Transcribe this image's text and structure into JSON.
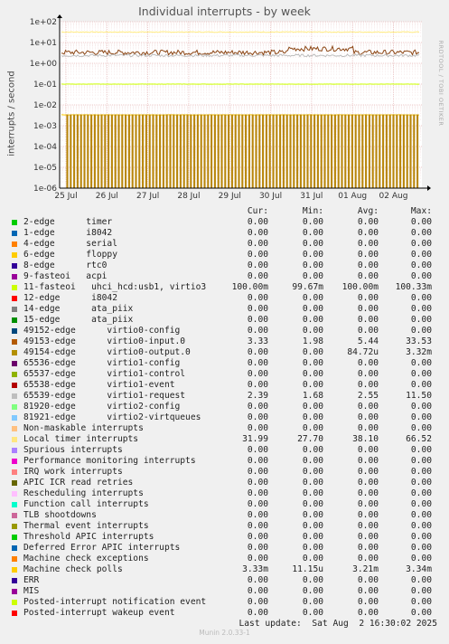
{
  "chart_data": {
    "type": "line",
    "title": "Individual interrupts - by week",
    "ylabel": "interrupts / second",
    "yscale": "log",
    "ylim": [
      1e-06,
      100
    ],
    "yticks": [
      "1e+02",
      "1e+01",
      "1e+00",
      "1e-01",
      "1e-02",
      "1e-03",
      "1e-04",
      "1e-05",
      "1e-06"
    ],
    "xticks": [
      "25 Jul",
      "26 Jul",
      "27 Jul",
      "28 Jul",
      "29 Jul",
      "30 Jul",
      "31 Jul",
      "01 Aug",
      "02 Aug"
    ],
    "side_label": "RRDTOOL / TOBI OETIKER",
    "grid": true,
    "series": [
      {
        "name": "Local timer interrupts",
        "color": "#ffeb80",
        "level": 31.99
      },
      {
        "name": "49153-edge virtio0-input.0",
        "color": "#8b4513",
        "level": 3.33
      },
      {
        "name": "65539-edge virtio1-request",
        "color": "#bbbbbb",
        "level": 2.39
      },
      {
        "name": "11-fasteoi uhci_hcd:usb1, virtio3",
        "color": "#ccff00",
        "level": 0.1
      },
      {
        "name": "Machine check polls",
        "color": "#ffcc00",
        "level": 0.00333
      },
      {
        "name": "49154-edge virtio0-output.0",
        "color": "#b8860b",
        "level": 8.5e-05
      }
    ]
  },
  "legend": {
    "headers": {
      "cur": "Cur:",
      "min": "Min:",
      "avg": "Avg:",
      "max": "Max:"
    },
    "rows": [
      {
        "name": "2-edge      timer",
        "color": "#00cc00",
        "cur": "0.00",
        "min": "0.00",
        "avg": "0.00",
        "max": "0.00"
      },
      {
        "name": "1-edge      i8042",
        "color": "#0066b3",
        "cur": "0.00",
        "min": "0.00",
        "avg": "0.00",
        "max": "0.00"
      },
      {
        "name": "4-edge      serial",
        "color": "#ff8000",
        "cur": "0.00",
        "min": "0.00",
        "avg": "0.00",
        "max": "0.00"
      },
      {
        "name": "6-edge      floppy",
        "color": "#ffcc00",
        "cur": "0.00",
        "min": "0.00",
        "avg": "0.00",
        "max": "0.00"
      },
      {
        "name": "8-edge      rtc0",
        "color": "#330099",
        "cur": "0.00",
        "min": "0.00",
        "avg": "0.00",
        "max": "0.00"
      },
      {
        "name": "9-fasteoi   acpi",
        "color": "#990099",
        "cur": "0.00",
        "min": "0.00",
        "avg": "0.00",
        "max": "0.00"
      },
      {
        "name": "11-fasteoi   uhci_hcd:usb1, virtio3",
        "color": "#ccff00",
        "cur": "100.00m",
        "min": "99.67m",
        "avg": "100.00m",
        "max": "100.33m"
      },
      {
        "name": "12-edge      i8042",
        "color": "#ff0000",
        "cur": "0.00",
        "min": "0.00",
        "avg": "0.00",
        "max": "0.00"
      },
      {
        "name": "14-edge      ata_piix",
        "color": "#808080",
        "cur": "0.00",
        "min": "0.00",
        "avg": "0.00",
        "max": "0.00"
      },
      {
        "name": "15-edge      ata_piix",
        "color": "#008f00",
        "cur": "0.00",
        "min": "0.00",
        "avg": "0.00",
        "max": "0.00"
      },
      {
        "name": "49152-edge      virtio0-config",
        "color": "#00487d",
        "cur": "0.00",
        "min": "0.00",
        "avg": "0.00",
        "max": "0.00"
      },
      {
        "name": "49153-edge      virtio0-input.0",
        "color": "#b35a00",
        "cur": "3.33",
        "min": "1.98",
        "avg": "5.44",
        "max": "33.53"
      },
      {
        "name": "49154-edge      virtio0-output.0",
        "color": "#b38f00",
        "cur": "0.00",
        "min": "0.00",
        "avg": "84.72u",
        "max": "3.32m"
      },
      {
        "name": "65536-edge      virtio1-config",
        "color": "#6b006b",
        "cur": "0.00",
        "min": "0.00",
        "avg": "0.00",
        "max": "0.00"
      },
      {
        "name": "65537-edge      virtio1-control",
        "color": "#8fb300",
        "cur": "0.00",
        "min": "0.00",
        "avg": "0.00",
        "max": "0.00"
      },
      {
        "name": "65538-edge      virtio1-event",
        "color": "#b30000",
        "cur": "0.00",
        "min": "0.00",
        "avg": "0.00",
        "max": "0.00"
      },
      {
        "name": "65539-edge      virtio1-request",
        "color": "#bebebe",
        "cur": "2.39",
        "min": "1.68",
        "avg": "2.55",
        "max": "11.50"
      },
      {
        "name": "81920-edge      virtio2-config",
        "color": "#80ff80",
        "cur": "0.00",
        "min": "0.00",
        "avg": "0.00",
        "max": "0.00"
      },
      {
        "name": "81921-edge      virtio2-virtqueues",
        "color": "#80c9ff",
        "cur": "0.00",
        "min": "0.00",
        "avg": "0.00",
        "max": "0.00"
      },
      {
        "name": "Non-maskable interrupts",
        "color": "#ffc080",
        "cur": "0.00",
        "min": "0.00",
        "avg": "0.00",
        "max": "0.00"
      },
      {
        "name": "Local timer interrupts",
        "color": "#ffe680",
        "cur": "31.99",
        "min": "27.70",
        "avg": "38.10",
        "max": "66.52"
      },
      {
        "name": "Spurious interrupts",
        "color": "#aa80ff",
        "cur": "0.00",
        "min": "0.00",
        "avg": "0.00",
        "max": "0.00"
      },
      {
        "name": "Performance monitoring interrupts",
        "color": "#ee00cc",
        "cur": "0.00",
        "min": "0.00",
        "avg": "0.00",
        "max": "0.00"
      },
      {
        "name": "IRQ work interrupts",
        "color": "#ff8080",
        "cur": "0.00",
        "min": "0.00",
        "avg": "0.00",
        "max": "0.00"
      },
      {
        "name": "APIC ICR read retries",
        "color": "#666600",
        "cur": "0.00",
        "min": "0.00",
        "avg": "0.00",
        "max": "0.00"
      },
      {
        "name": "Rescheduling interrupts",
        "color": "#ffbfff",
        "cur": "0.00",
        "min": "0.00",
        "avg": "0.00",
        "max": "0.00"
      },
      {
        "name": "Function call interrupts",
        "color": "#00ffcc",
        "cur": "0.00",
        "min": "0.00",
        "avg": "0.00",
        "max": "0.00"
      },
      {
        "name": "TLB shootdowns",
        "color": "#cc6699",
        "cur": "0.00",
        "min": "0.00",
        "avg": "0.00",
        "max": "0.00"
      },
      {
        "name": "Thermal event interrupts",
        "color": "#999900",
        "cur": "0.00",
        "min": "0.00",
        "avg": "0.00",
        "max": "0.00"
      },
      {
        "name": "Threshold APIC interrupts",
        "color": "#00cc00",
        "cur": "0.00",
        "min": "0.00",
        "avg": "0.00",
        "max": "0.00"
      },
      {
        "name": "Deferred Error APIC interrupts",
        "color": "#0066b3",
        "cur": "0.00",
        "min": "0.00",
        "avg": "0.00",
        "max": "0.00"
      },
      {
        "name": "Machine check exceptions",
        "color": "#ff8000",
        "cur": "0.00",
        "min": "0.00",
        "avg": "0.00",
        "max": "0.00"
      },
      {
        "name": "Machine check polls",
        "color": "#ffcc00",
        "cur": "3.33m",
        "min": "11.15u",
        "avg": "3.21m",
        "max": "3.34m"
      },
      {
        "name": "ERR",
        "color": "#330099",
        "cur": "0.00",
        "min": "0.00",
        "avg": "0.00",
        "max": "0.00"
      },
      {
        "name": "MIS",
        "color": "#990099",
        "cur": "0.00",
        "min": "0.00",
        "avg": "0.00",
        "max": "0.00"
      },
      {
        "name": "Posted-interrupt notification event",
        "color": "#ccff00",
        "cur": "0.00",
        "min": "0.00",
        "avg": "0.00",
        "max": "0.00"
      },
      {
        "name": "Posted-interrupt wakeup event",
        "color": "#ff0000",
        "cur": "0.00",
        "min": "0.00",
        "avg": "0.00",
        "max": "0.00"
      }
    ]
  },
  "last_update": "Last update:  Sat Aug  2 16:30:02 2025",
  "footer": "Munin 2.0.33-1"
}
